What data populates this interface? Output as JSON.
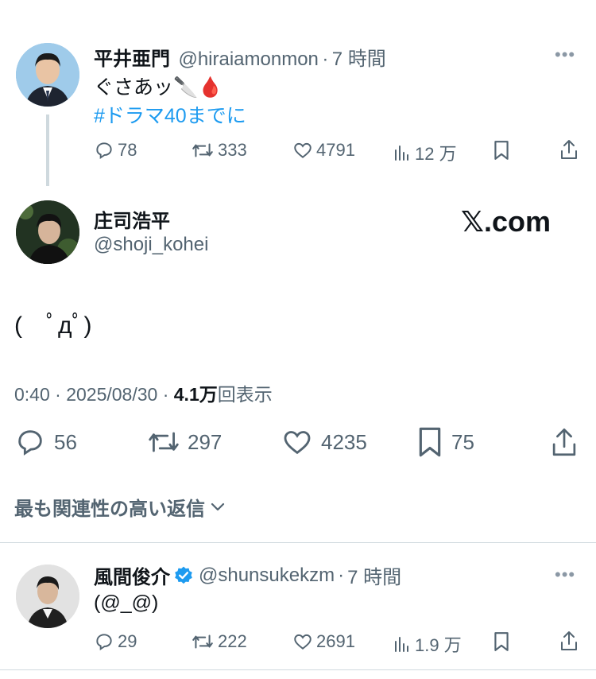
{
  "tweet1": {
    "name": "平井亜門",
    "handle": "@hiraiamonmon",
    "sep": "·",
    "time": "7 時間",
    "text": "ぐさあッ🔪🩸",
    "hashtag": "#ドラマ40までに",
    "replies": "78",
    "retweets": "333",
    "likes": "4791",
    "views": "12 万"
  },
  "main": {
    "name": "庄司浩平",
    "handle": "@shoji_kohei",
    "watermark": "𝕏.com",
    "text": "(　ﾟдﾟ)",
    "time": "0:40 · 2025/08/30 · ",
    "views_count": "4.1万",
    "views_label": "回表示",
    "replies": "56",
    "retweets": "297",
    "likes": "4235",
    "bookmarks": "75"
  },
  "sort": {
    "label": "最も関連性の高い返信"
  },
  "reply": {
    "name": "風間俊介",
    "handle": "@shunsukekzm",
    "sep": "·",
    "time": "7 時間",
    "text": "(@_@)",
    "replies": "29",
    "retweets": "222",
    "likes": "2691",
    "views": "1.9 万"
  },
  "colors": {
    "accent": "#1d9bf0",
    "muted": "#536471",
    "blood": "#c8102e"
  },
  "icons": [
    "reply-icon",
    "retweet-icon",
    "heart-icon",
    "views-icon",
    "bookmark-icon",
    "share-icon",
    "more-icon",
    "verified-icon",
    "chevron-down-icon"
  ]
}
